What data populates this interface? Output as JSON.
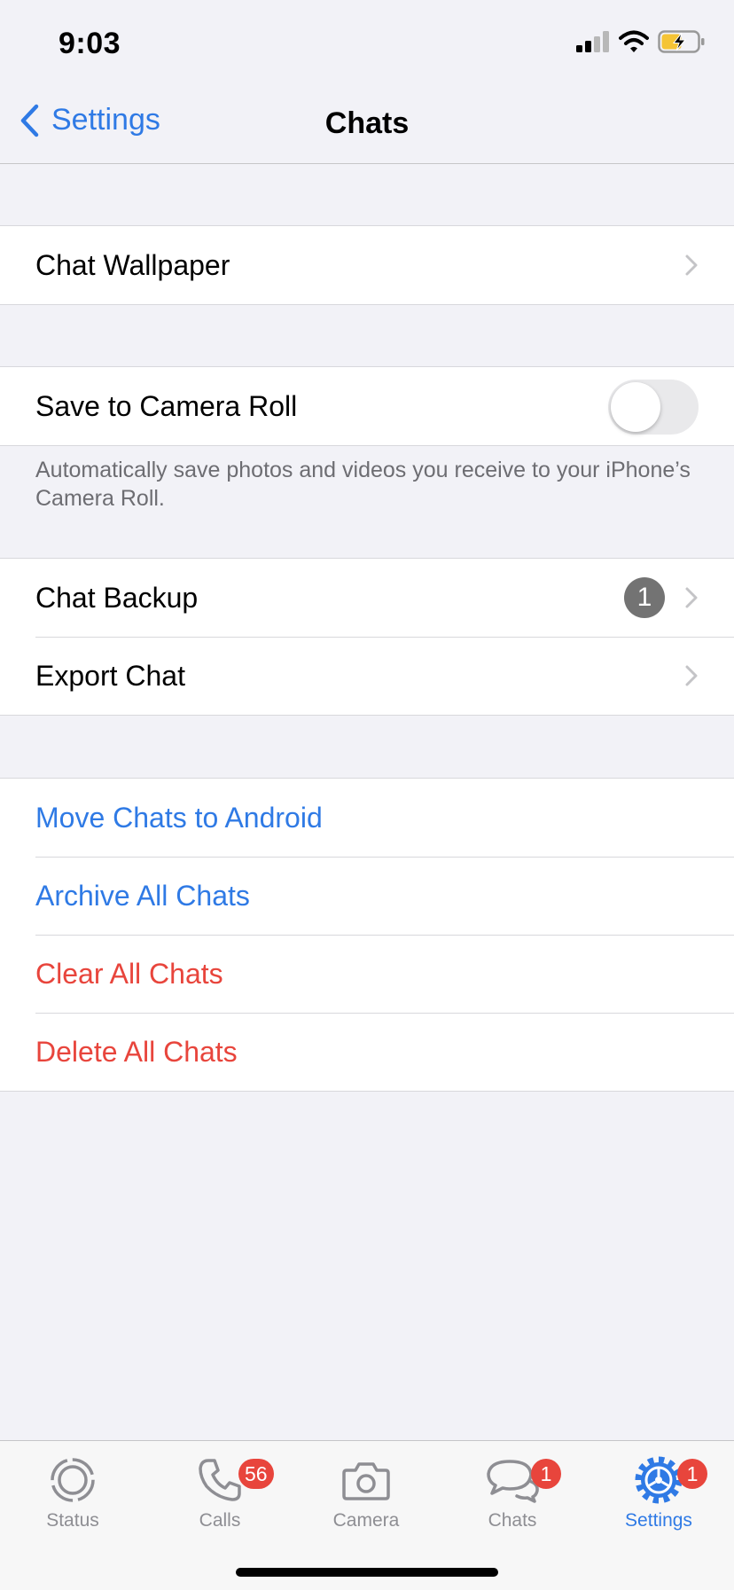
{
  "status_bar": {
    "time": "9:03"
  },
  "nav": {
    "back_label": "Settings",
    "title": "Chats"
  },
  "sections": {
    "wallpaper": {
      "label": "Chat Wallpaper"
    },
    "camera_roll": {
      "label": "Save to Camera Roll",
      "enabled": false,
      "footnote": "Automatically save photos and videos you receive to your iPhone’s Camera Roll."
    },
    "backup": {
      "label": "Chat Backup",
      "badge": "1"
    },
    "export": {
      "label": "Export Chat"
    },
    "actions": [
      {
        "label": "Move Chats to Android",
        "color": "#2f7ae5"
      },
      {
        "label": "Archive All Chats",
        "color": "#2f7ae5"
      },
      {
        "label": "Clear All Chats",
        "color": "#e8453c"
      },
      {
        "label": "Delete All Chats",
        "color": "#e8453c"
      }
    ]
  },
  "tab_bar": {
    "tabs": [
      {
        "label": "Status",
        "icon": "status-icon",
        "badge": ""
      },
      {
        "label": "Calls",
        "icon": "phone-icon",
        "badge": "56"
      },
      {
        "label": "Camera",
        "icon": "camera-icon",
        "badge": ""
      },
      {
        "label": "Chats",
        "icon": "chat-bubbles-icon",
        "badge": "1"
      },
      {
        "label": "Settings",
        "icon": "gear-icon",
        "badge": "1",
        "active": true
      }
    ]
  },
  "colors": {
    "accent": "#2f7ae5",
    "destructive": "#e8453c",
    "background": "#f2f2f7"
  }
}
